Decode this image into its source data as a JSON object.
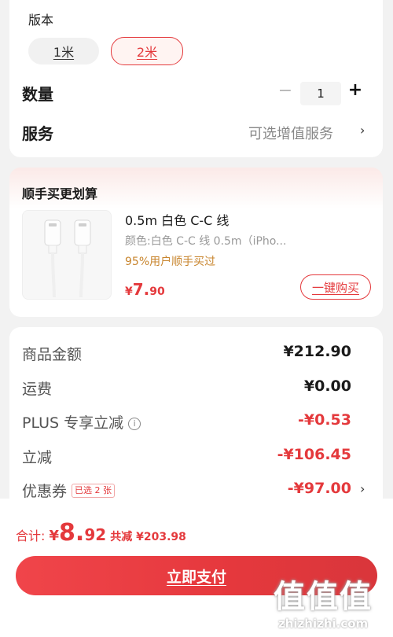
{
  "spec": {
    "version_label": "版本",
    "options": [
      {
        "label": "1米",
        "selected": false
      },
      {
        "label": "2米",
        "selected": true
      }
    ],
    "quantity_label": "数量",
    "quantity_value": "1",
    "minus": "−",
    "plus": "+",
    "service_label": "服务",
    "service_link": "可选增值服务",
    "chevron": "›"
  },
  "addon": {
    "title": "顺手买更划算",
    "product_name": "0.5m 白色 C-C 线",
    "product_spec": "颜色:白色 C-C 线 0.5m（iPho...",
    "tip": "95%用户顺手买过",
    "price_symbol": "¥",
    "price_int": "7.",
    "price_dec": "90",
    "quick_buy": "一键购买"
  },
  "price_breakdown": {
    "rows": [
      {
        "label": "商品金额",
        "value": "¥212.90",
        "red": false
      },
      {
        "label": "运费",
        "value": "¥0.00",
        "red": false
      },
      {
        "label": "PLUS 专享立减",
        "value": "-¥0.53",
        "red": true,
        "info_icon": "i"
      },
      {
        "label": "立减",
        "value": "-¥106.45",
        "red": true
      },
      {
        "label": "优惠券",
        "value": "-¥97.00",
        "red": true,
        "badge": "已选 2 张",
        "chevron": "›"
      }
    ]
  },
  "bottom": {
    "total_label": "合计:",
    "total_symbol": "¥",
    "total_int": "8.",
    "total_dec": "92",
    "saved": "共减 ¥203.98",
    "pay_label": "立即支付",
    "watermark_glyphs": "值值值",
    "watermark_url": "zhizhizhi.com"
  },
  "colors": {
    "accent": "#e4393c",
    "tip": "#c8852e",
    "background": "#f2f2f2"
  }
}
